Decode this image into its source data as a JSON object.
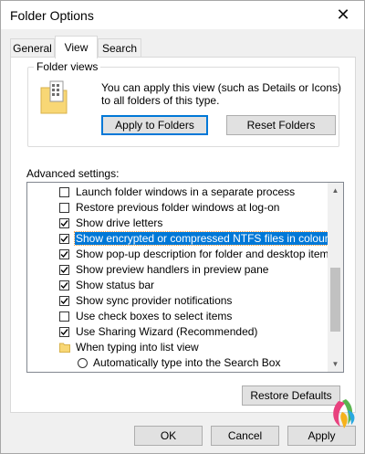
{
  "window": {
    "title": "Folder Options",
    "close_glyph": "✕"
  },
  "tabs": [
    {
      "label": "General",
      "active": false
    },
    {
      "label": "View",
      "active": true
    },
    {
      "label": "Search",
      "active": false
    }
  ],
  "folder_views": {
    "label": "Folder views",
    "description": "You can apply this view (such as Details or Icons) to all folders of this type.",
    "apply_button": "Apply to Folders",
    "reset_button": "Reset Folders"
  },
  "advanced": {
    "label": "Advanced settings:",
    "items": [
      {
        "type": "checkbox",
        "checked": false,
        "label": "Launch folder windows in a separate process"
      },
      {
        "type": "checkbox",
        "checked": false,
        "label": "Restore previous folder windows at log-on"
      },
      {
        "type": "checkbox",
        "checked": true,
        "label": "Show drive letters"
      },
      {
        "type": "checkbox",
        "checked": true,
        "label": "Show encrypted or compressed NTFS files in colour",
        "selected": true
      },
      {
        "type": "checkbox",
        "checked": true,
        "label": "Show pop-up description for folder and desktop items"
      },
      {
        "type": "checkbox",
        "checked": true,
        "label": "Show preview handlers in preview pane"
      },
      {
        "type": "checkbox",
        "checked": true,
        "label": "Show status bar"
      },
      {
        "type": "checkbox",
        "checked": true,
        "label": "Show sync provider notifications"
      },
      {
        "type": "checkbox",
        "checked": false,
        "label": "Use check boxes to select items"
      },
      {
        "type": "checkbox",
        "checked": true,
        "label": "Use Sharing Wizard (Recommended)"
      },
      {
        "type": "folder",
        "label": "When typing into list view"
      },
      {
        "type": "radio",
        "checked": false,
        "label": "Automatically type into the Search Box"
      }
    ]
  },
  "restore_defaults_button": "Restore Defaults",
  "footer": {
    "ok": "OK",
    "cancel": "Cancel",
    "apply": "Apply"
  },
  "colors": {
    "accent": "#0078d7",
    "selection": "#0078d7",
    "folder": "#f8d775"
  }
}
